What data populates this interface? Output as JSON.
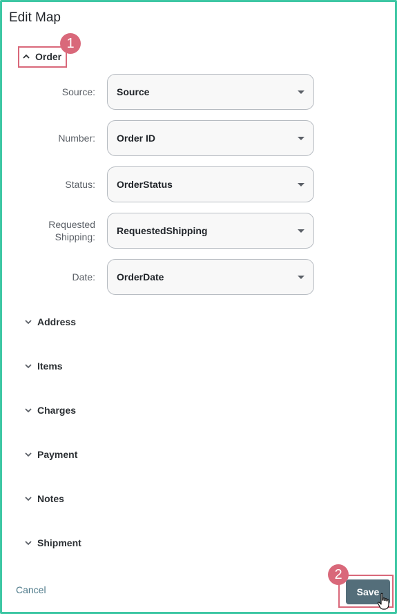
{
  "dialog": {
    "title": "Edit Map"
  },
  "sections": {
    "order": "Order",
    "address": "Address",
    "items": "Items",
    "charges": "Charges",
    "payment": "Payment",
    "notes": "Notes",
    "shipment": "Shipment"
  },
  "fields": [
    {
      "label": "Source:",
      "value": "Source"
    },
    {
      "label": "Number:",
      "value": "Order ID"
    },
    {
      "label": "Status:",
      "value": "OrderStatus"
    },
    {
      "label": "Requested Shipping:",
      "value": "RequestedShipping"
    },
    {
      "label": "Date:",
      "value": "OrderDate"
    }
  ],
  "markers": {
    "step1": "1",
    "step2": "2"
  },
  "actions": {
    "cancel": "Cancel",
    "save": "Save"
  },
  "colors": {
    "border_accent": "#3ec7a4",
    "highlight": "#d9687a",
    "save_button": "#546e7a",
    "cancel_link": "#4e7a8a"
  },
  "icons": {
    "expanded": "chevron-up-icon",
    "collapsed": "chevron-down-icon",
    "dropdown": "caret-down-icon",
    "pointer": "hand-pointer-icon"
  }
}
